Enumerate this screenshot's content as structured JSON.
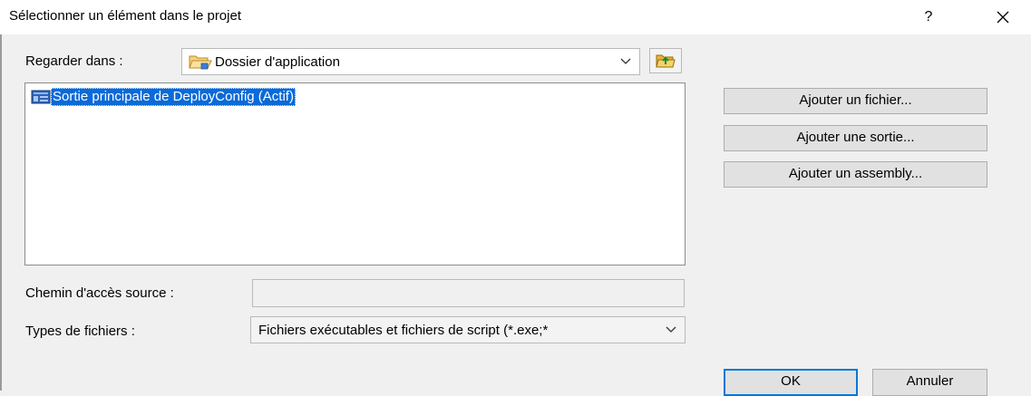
{
  "dialog": {
    "title": "Sélectionner un élément dans le projet",
    "help_label": "?",
    "close_icon": "close-icon"
  },
  "look_in": {
    "label": "Regarder dans :",
    "value": "Dossier d'application",
    "folder_icon": "folder-icon",
    "up_icon": "up-folder-icon"
  },
  "file_list": {
    "items": [
      {
        "label": "Sortie principale de DeployConfig (Actif)",
        "selected": true,
        "icon": "project-output-icon"
      }
    ]
  },
  "actions": {
    "add_file": "Ajouter un fichier...",
    "add_output": "Ajouter une sortie...",
    "add_assembly": "Ajouter un assembly..."
  },
  "source_path": {
    "label": "Chemin d'accès source :",
    "value": ""
  },
  "file_types": {
    "label": "Types de fichiers :",
    "value": "Fichiers exécutables et fichiers de script (*.exe;*"
  },
  "footer": {
    "ok": "OK",
    "cancel": "Annuler"
  },
  "colors": {
    "selection": "#0a6ad8",
    "default_button_border": "#0078d7",
    "dialog_bg": "#f0f0f0"
  }
}
